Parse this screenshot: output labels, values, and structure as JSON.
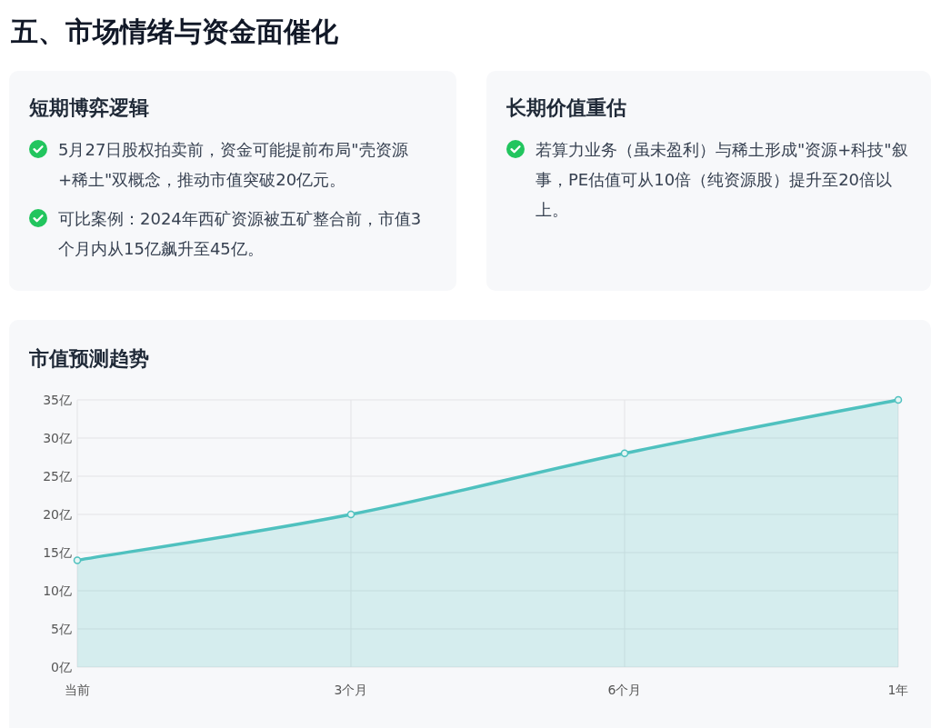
{
  "heading": "五、市场情绪与资金面催化",
  "cards": [
    {
      "title": "短期博弈逻辑",
      "points": [
        "5月27日股权拍卖前，资金可能提前布局\"壳资源+稀土\"双概念，推动市值突破20亿元。",
        "可比案例：2024年西矿资源被五矿整合前，市值3个月内从15亿飙升至45亿。"
      ]
    },
    {
      "title": "长期价值重估",
      "points": [
        "若算力业务（虽未盈利）与稀土形成\"资源+科技\"叙事，PE估值可从10倍（纯资源股）提升至20倍以上。"
      ]
    }
  ],
  "chart_card": {
    "title": "市值预测趋势",
    "chart_data": {
      "type": "area",
      "categories": [
        "当前",
        "3个月",
        "6个月",
        "1年"
      ],
      "series": [
        {
          "color": "#4fc1bf",
          "values": [
            14,
            20,
            28,
            35
          ]
        }
      ],
      "ylim": [
        0,
        35
      ],
      "grid": true,
      "yticks": [
        {
          "value": 0,
          "label": "0亿"
        },
        {
          "value": 5,
          "label": "5亿"
        },
        {
          "value": 10,
          "label": "10亿"
        },
        {
          "value": 15,
          "label": "15亿"
        },
        {
          "value": 20,
          "label": "20亿"
        },
        {
          "value": 25,
          "label": "25亿"
        },
        {
          "value": 30,
          "label": "30亿"
        },
        {
          "value": 35,
          "label": "35亿"
        }
      ]
    }
  }
}
